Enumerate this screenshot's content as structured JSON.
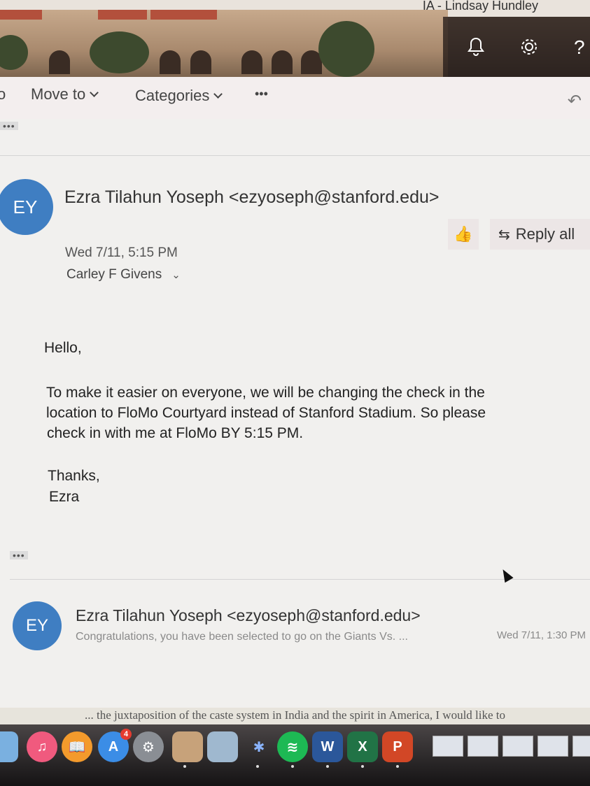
{
  "header": {
    "user_name": "IA - Lindsay Hundley",
    "icons": [
      "bell-icon",
      "gear-icon",
      "help-icon"
    ]
  },
  "toolbar": {
    "partial_label": "o",
    "move_to_label": "Move to",
    "categories_label": "Categories",
    "more_label": "•••",
    "undo_icon": "undo-icon"
  },
  "collapsed_dots": "•••",
  "message": {
    "avatar_initials": "EY",
    "sender": "Ezra Tilahun Yoseph <ezyoseph@stanford.edu>",
    "date": "Wed 7/11, 5:15 PM",
    "recipient": "Carley F Givens",
    "reply_all_label": "Reply all",
    "body": {
      "greeting": "Hello,",
      "line1": "To make it easier on everyone, we will be changing the check in the",
      "line2": "location to FloMo Courtyard instead of Stanford Stadium. So please",
      "line3": "check in with me at FloMo BY 5:15 PM.",
      "closing": "Thanks,",
      "signature": "Ezra"
    },
    "show_more_dots": "•••"
  },
  "thread_item": {
    "avatar_initials": "EY",
    "sender": "Ezra Tilahun Yoseph <ezyoseph@stanford.edu>",
    "preview": "Congratulations, you have been selected to go on the Giants Vs. ...",
    "date": "Wed 7/11, 1:30 PM"
  },
  "background_doc_text": "... the juxtaposition of the caste system in India and the spirit in America, I would like to",
  "dock": {
    "apps": [
      "Finder",
      "iTunes",
      "iBooks",
      "App Store",
      "System Preferences",
      "Preview",
      "Image Capture",
      "Bluetooth",
      "Spotify",
      "Word",
      "Excel",
      "PowerPoint"
    ],
    "app_store_badge": "4",
    "word_letter": "W",
    "excel_letter": "X",
    "ppt_letter": "P"
  }
}
